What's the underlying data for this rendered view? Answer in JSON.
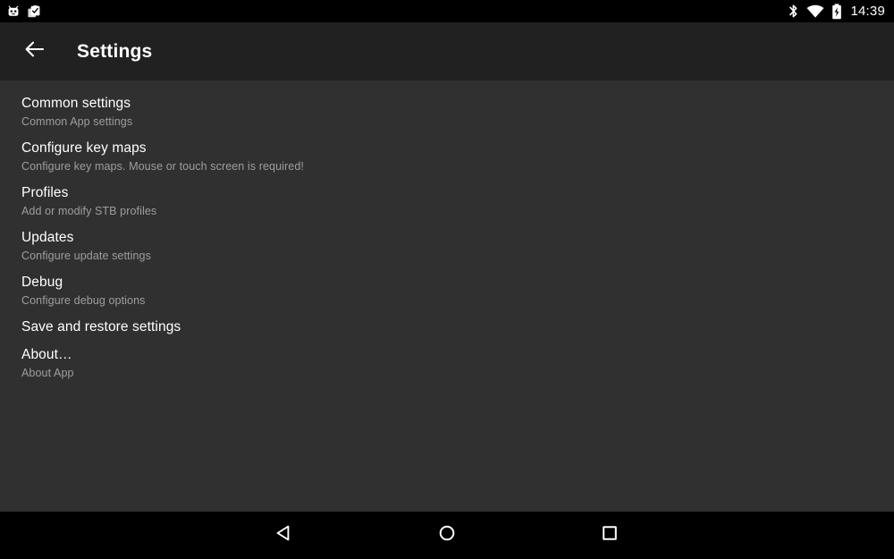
{
  "status_bar": {
    "left_icons": [
      {
        "name": "android-robot-icon",
        "label": "Android app notification"
      },
      {
        "name": "clipboard-check-icon",
        "label": "Task clipboard notification"
      }
    ],
    "right_icons": [
      {
        "name": "bluetooth-icon",
        "label": "Bluetooth on"
      },
      {
        "name": "wifi-icon",
        "label": "Wi-Fi connected"
      },
      {
        "name": "battery-charging-icon",
        "label": "Battery charging"
      }
    ],
    "clock": "14:39"
  },
  "toolbar": {
    "back_icon": "arrow-left-icon",
    "title": "Settings"
  },
  "settings": {
    "items": [
      {
        "title": "Common settings",
        "subtitle": "Common App settings",
        "key": "common-settings"
      },
      {
        "title": "Configure key maps",
        "subtitle": "Configure key maps. Mouse or touch screen is required!",
        "key": "configure-key-maps"
      },
      {
        "title": "Profiles",
        "subtitle": "Add or modify STB profiles",
        "key": "profiles"
      },
      {
        "title": "Updates",
        "subtitle": "Configure update settings",
        "key": "updates"
      },
      {
        "title": "Debug",
        "subtitle": "Configure debug options",
        "key": "debug"
      },
      {
        "title": "Save and restore settings",
        "subtitle": "",
        "key": "save-and-restore-settings"
      },
      {
        "title": "About…",
        "subtitle": "About App",
        "key": "about"
      }
    ]
  },
  "navigation_bar": {
    "buttons": [
      {
        "name": "nav-back-icon",
        "label": "Back"
      },
      {
        "name": "nav-home-icon",
        "label": "Home"
      },
      {
        "name": "nav-recents-icon",
        "label": "Recent apps"
      }
    ]
  },
  "colors": {
    "status_bar_bg": "#000000",
    "toolbar_bg": "#212121",
    "content_bg": "#303030",
    "nav_bar_bg": "#000000",
    "primary_text": "#ffffff",
    "secondary_text": "#9e9e9e"
  }
}
